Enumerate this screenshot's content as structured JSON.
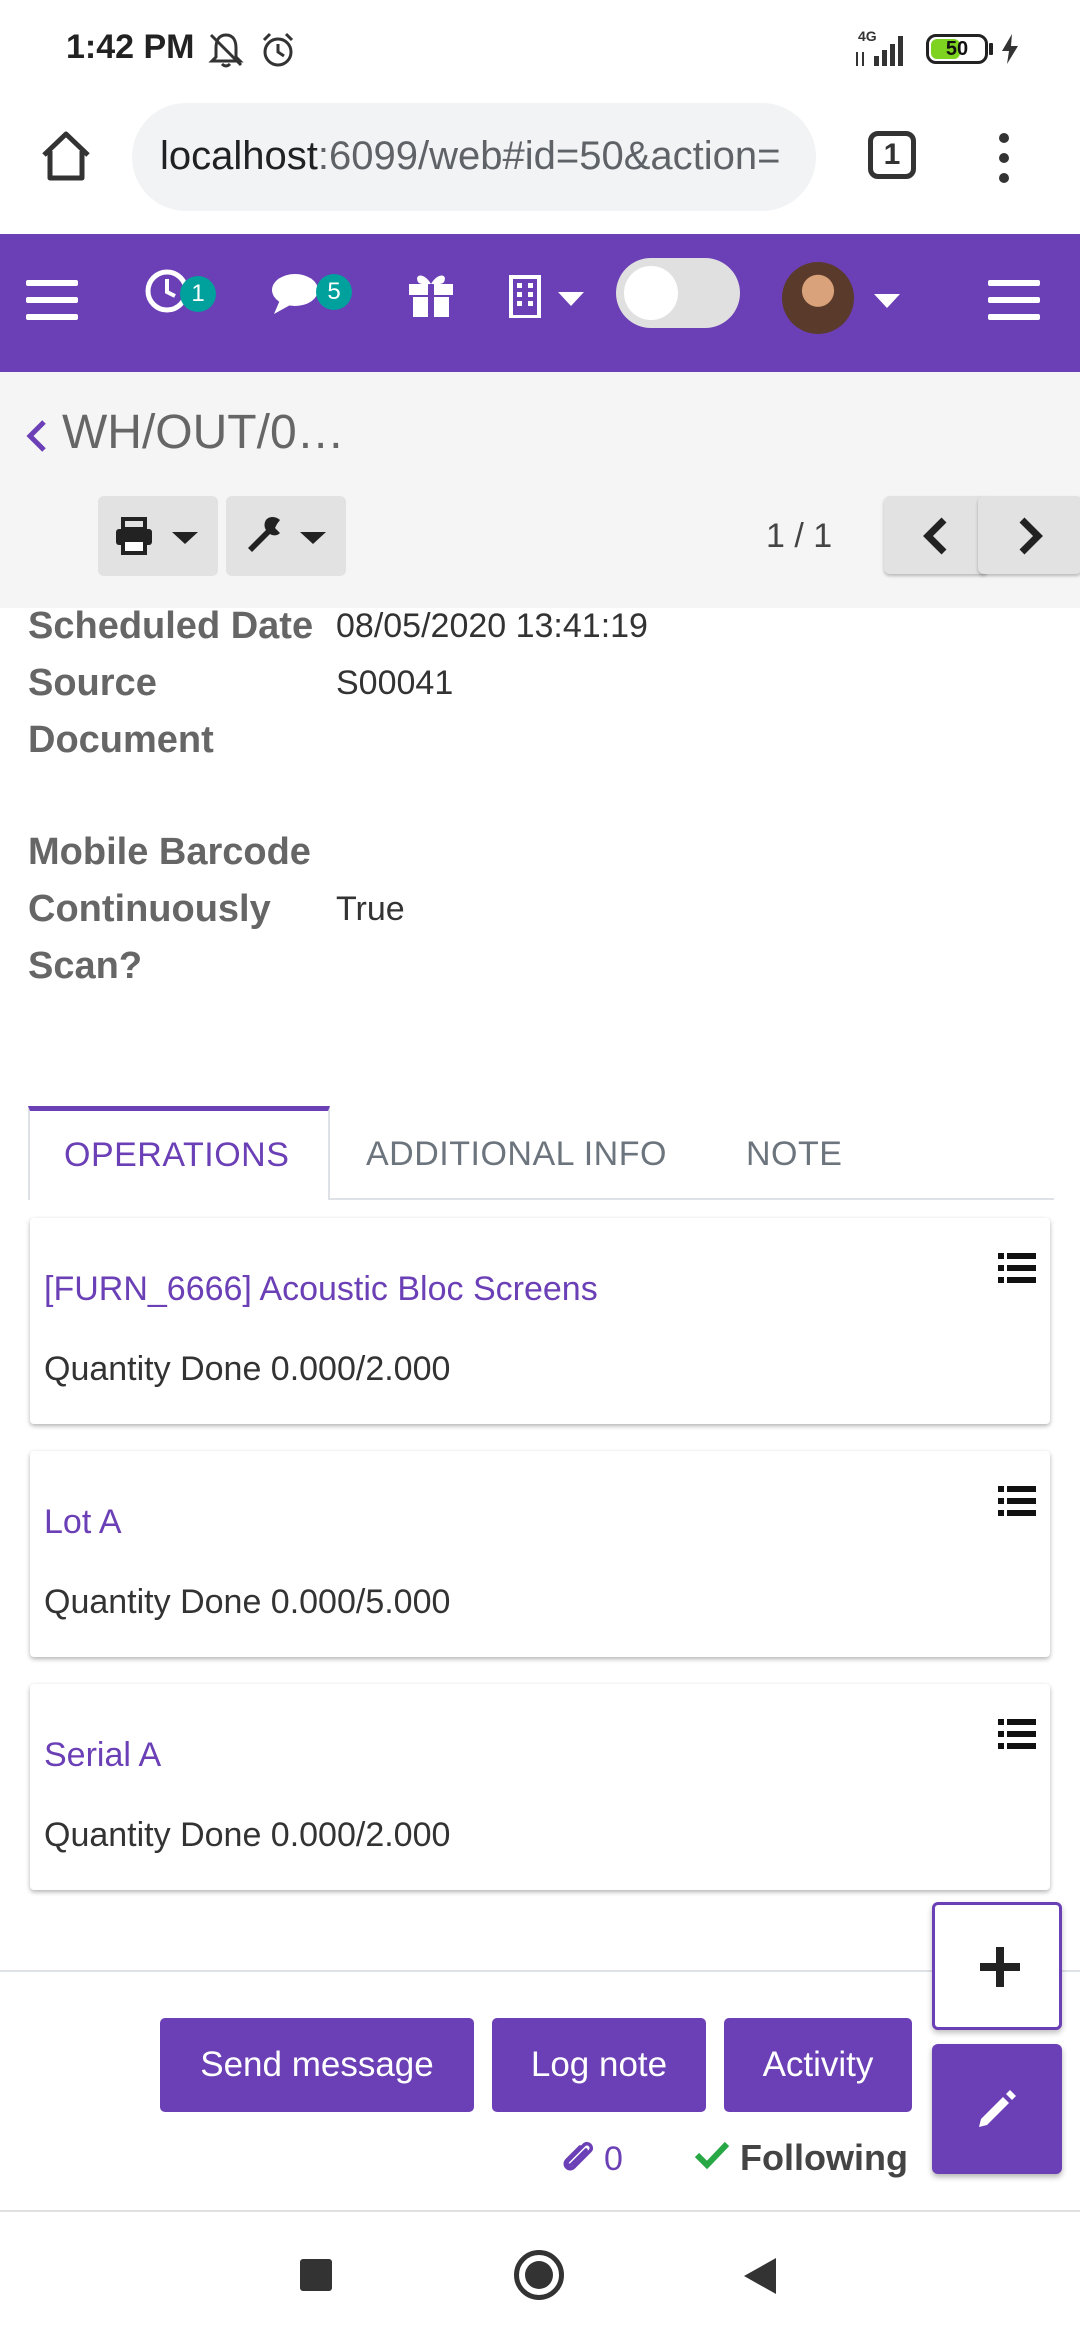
{
  "status_bar": {
    "time": "1:42 PM",
    "network": "4G",
    "battery": "50"
  },
  "browser": {
    "url_host": "localhost",
    "url_rest": ":6099/web#id=50&action=",
    "tab_count": "1"
  },
  "navbar": {
    "activity_count": "1",
    "message_count": "5"
  },
  "control_panel": {
    "breadcrumb": "WH/OUT/0…",
    "pager": "1 / 1"
  },
  "form": {
    "fields": [
      {
        "label": "Scheduled Date",
        "value": "08/05/2020 13:41:19"
      },
      {
        "label": "Source Document",
        "value": "S00041"
      },
      {
        "label": "Mobile Barcode Continuously Scan?",
        "value": "True"
      }
    ],
    "label_lines": {
      "source_1": "Source",
      "source_2": "Document",
      "mobile_1": "Mobile Barcode",
      "mobile_2": "Continuously",
      "mobile_3": "Scan?"
    }
  },
  "tabs": [
    "OPERATIONS",
    "ADDITIONAL INFO",
    "NOTE"
  ],
  "operations": [
    {
      "title": "[FURN_6666] Acoustic Bloc Screens",
      "qty": "Quantity Done 0.000/2.000"
    },
    {
      "title": "Lot A",
      "qty": "Quantity Done 0.000/5.000"
    },
    {
      "title": "Serial A",
      "qty": "Quantity Done 0.000/2.000"
    }
  ],
  "chatter": {
    "send_message": "Send message",
    "log_note": "Log note",
    "activity": "Activity",
    "attachments": "0",
    "following": "Following"
  },
  "colors": {
    "primary": "#6b3fb5",
    "badge": "#00a09d",
    "following_check": "#28a745"
  }
}
